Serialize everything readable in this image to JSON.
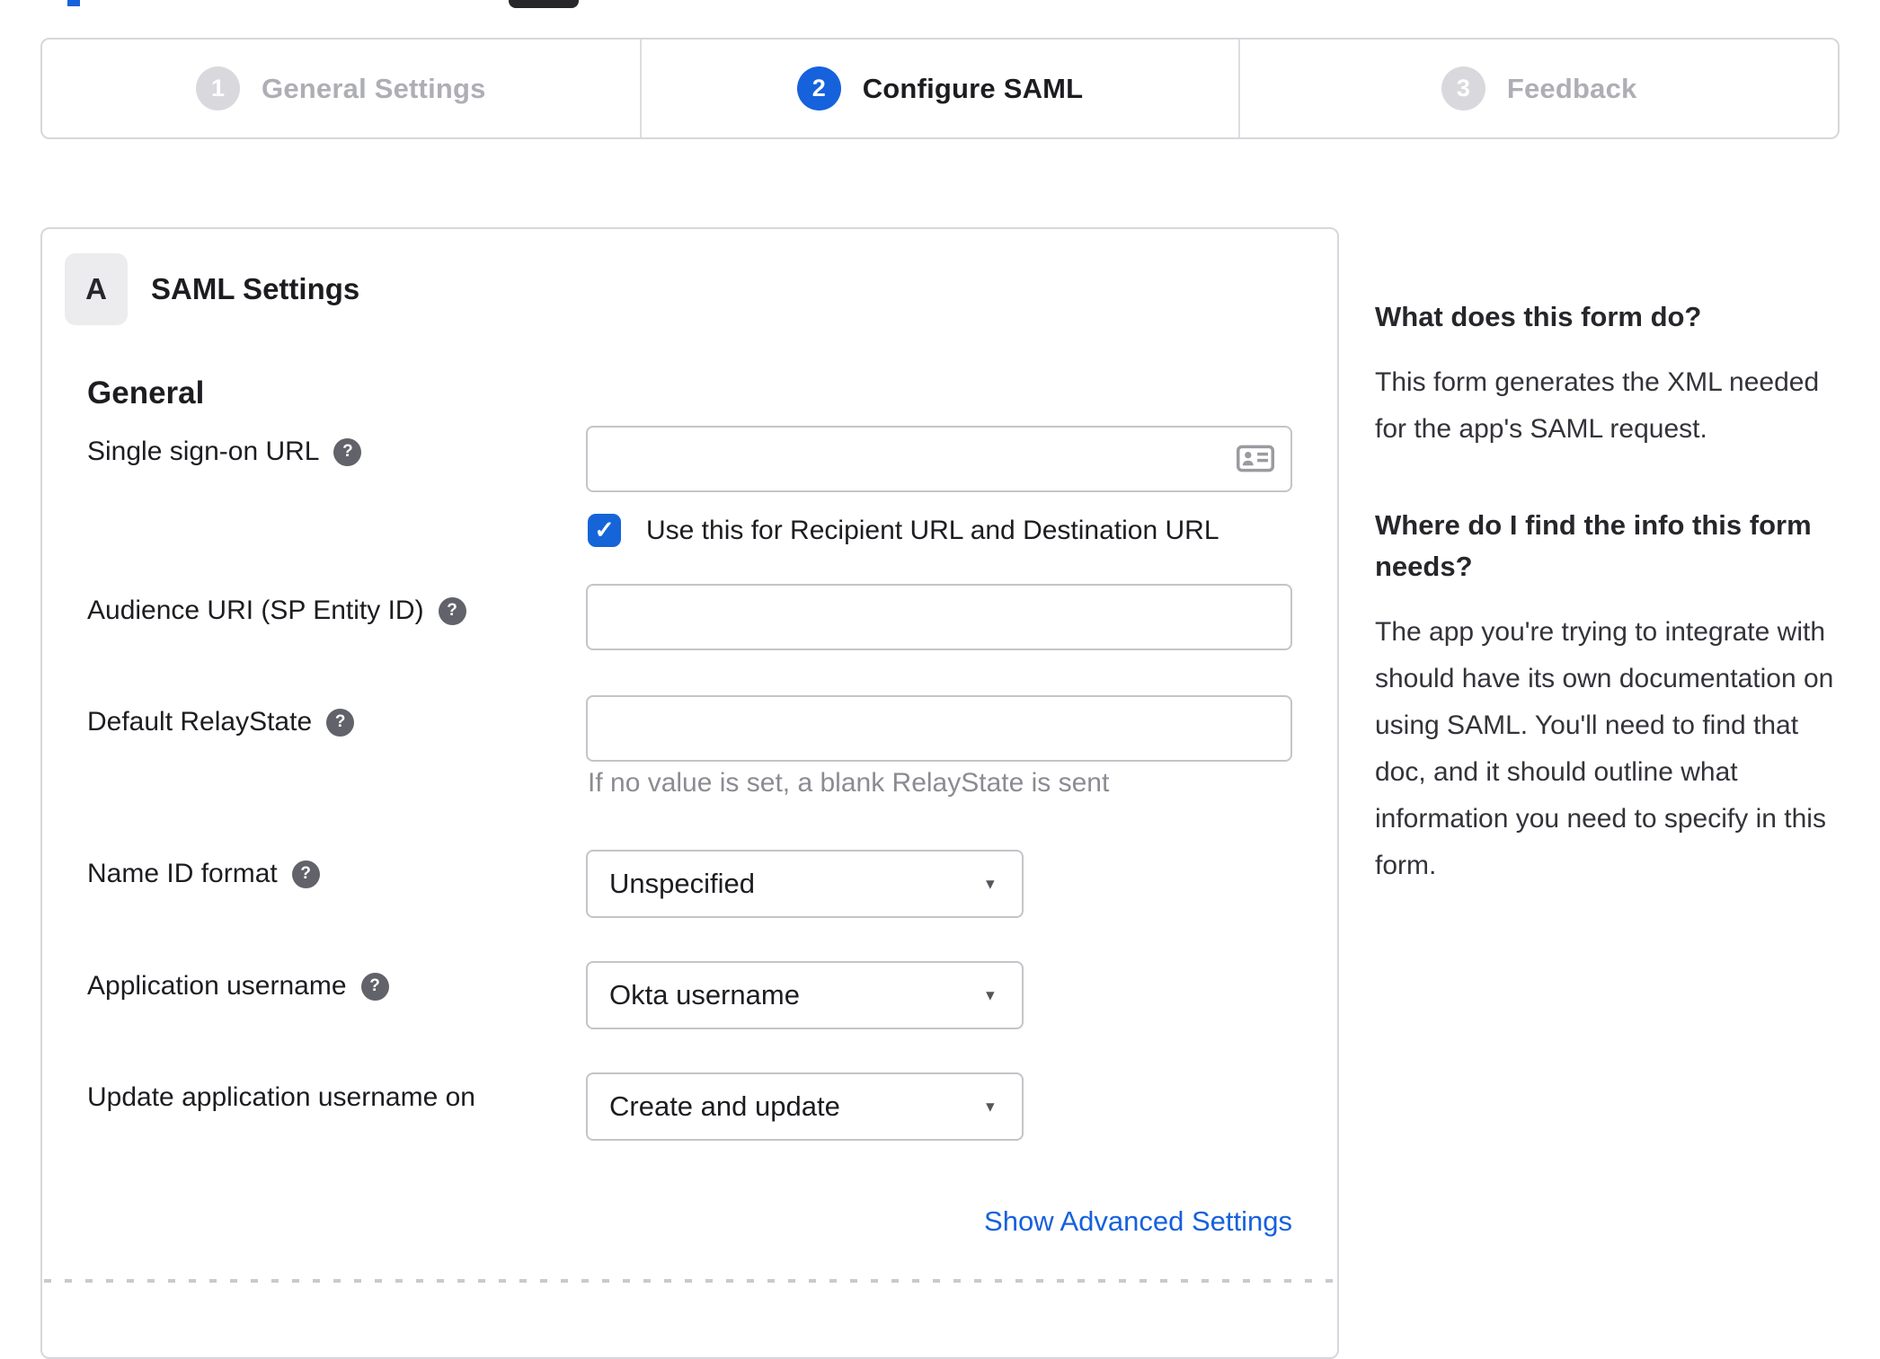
{
  "colors": {
    "accent": "#1662dd",
    "border": "#d7d7dc",
    "text": "#1d1d21",
    "muted_text": "#8b8b93",
    "inactive_step_text": "#aeaeb5",
    "inactive_step_circle": "#d9d9dd",
    "link": "#1661dd"
  },
  "icons": {
    "help": "?",
    "checkmark": "✓",
    "dropdown_arrow": "▼",
    "sso_input_trailing": "contact-card"
  },
  "stepper": {
    "steps": [
      {
        "number": "1",
        "label": "General Settings",
        "state": "inactive"
      },
      {
        "number": "2",
        "label": "Configure SAML",
        "state": "active"
      },
      {
        "number": "3",
        "label": "Feedback",
        "state": "inactive"
      }
    ]
  },
  "panel": {
    "badge": "A",
    "title": "SAML Settings",
    "section": "General",
    "fields": {
      "sso_url": {
        "label": "Single sign-on URL",
        "value": ""
      },
      "sso_checkbox": {
        "label": "Use this for Recipient URL and Destination URL",
        "checked": true
      },
      "audience_uri": {
        "label": "Audience URI (SP Entity ID)",
        "value": ""
      },
      "relay_state": {
        "label": "Default RelayState",
        "value": "",
        "hint": "If no value is set, a blank RelayState is sent"
      },
      "name_id_format": {
        "label": "Name ID format",
        "value": "Unspecified"
      },
      "app_username": {
        "label": "Application username",
        "value": "Okta username"
      },
      "update_app_username": {
        "label": "Update application username on",
        "value": "Create and update"
      }
    },
    "advanced_link": "Show Advanced Settings"
  },
  "sidebar": {
    "blocks": [
      {
        "heading": "What does this form do?",
        "body": "This form generates the XML needed for the app's SAML request."
      },
      {
        "heading": "Where do I find the info this form needs?",
        "body": "The app you're trying to integrate with should have its own documentation on using SAML. You'll need to find that doc, and it should outline what information you need to specify in this form."
      }
    ]
  }
}
